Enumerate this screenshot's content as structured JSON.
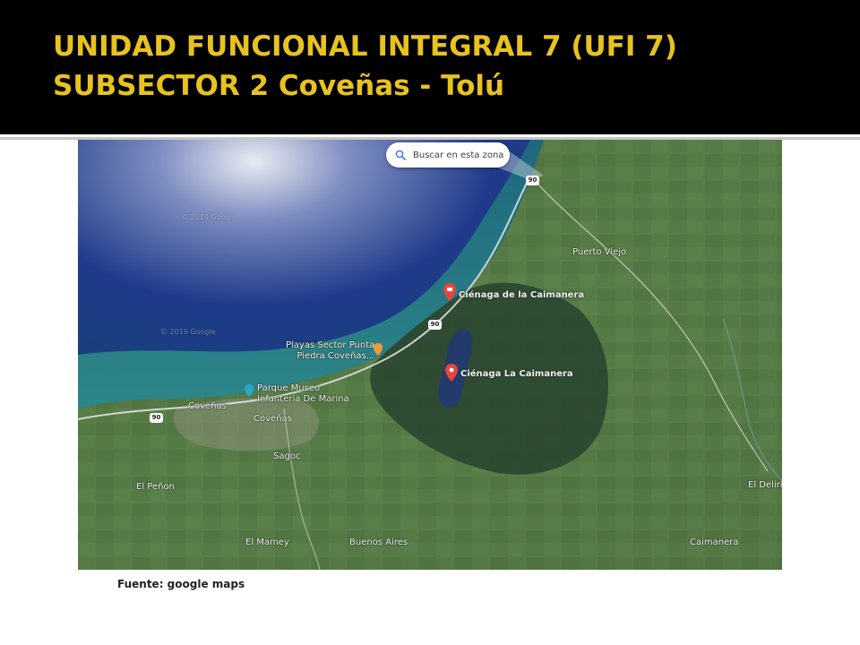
{
  "slide": {
    "title_line1": "UNIDAD FUNCIONAL INTEGRAL  7 (UFI 7)",
    "title_line2": "SUBSECTOR 2 Coveñas   - Tolú",
    "caption": "Fuente: google maps",
    "colors": {
      "title_bg": "#000000",
      "title_text": "#e8c21f"
    }
  },
  "map": {
    "search_label": "Buscar en esta zona",
    "search_icon": "search-icon",
    "route_shields": [
      "90",
      "90",
      "90"
    ],
    "places": {
      "puerto_viejo": "Puerto Viejo",
      "cienaga_caimanera_1": "Ciénaga de la Caimanera",
      "cienaga_caimanera_2": "Ciénaga La Caimanera",
      "playas_line1": "Playas Sector Punta",
      "playas_line2": "Piedra Coveñas...",
      "parque_line1": "Parque Museo",
      "parque_line2": "Infantería De Marina",
      "covenas_town": "Coveñas",
      "covenas_label": "Coveñas",
      "sagoc": "Sagoc",
      "el_penon": "El Peñon",
      "el_mamey": "El Mamey",
      "buenos_aires": "Buenos Aires",
      "caimanera": "Caimanera",
      "el_delirio": "El Delirio"
    },
    "watermark_1": "© 2019 Google",
    "watermark_2": "© 2019 Google"
  }
}
